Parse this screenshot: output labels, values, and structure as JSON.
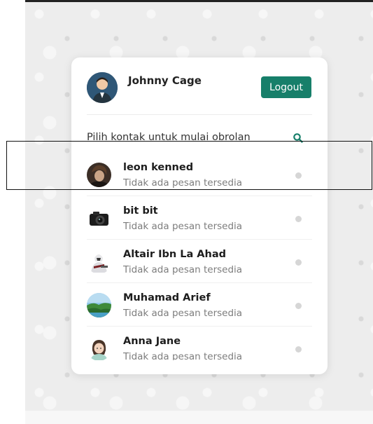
{
  "user": {
    "name": "Johnny Cage"
  },
  "header": {
    "logout_label": "Logout"
  },
  "search": {
    "placeholder": "Pilih kontak untuk mulai obrolan"
  },
  "contacts": [
    {
      "name": "leon kenned",
      "message": "Tidak ada pesan tersedia"
    },
    {
      "name": "bit bit",
      "message": "Tidak ada pesan tersedia"
    },
    {
      "name": "Altair Ibn La Ahad",
      "message": "Tidak ada pesan tersedia"
    },
    {
      "name": "Muhamad Arief",
      "message": "Tidak ada pesan tersedia"
    },
    {
      "name": "Anna Jane",
      "message": "Tidak ada pesan tersedia"
    }
  ],
  "colors": {
    "accent": "#177f6a",
    "status_dot": "#d6d6d6",
    "background_pattern": "#ededed"
  },
  "icons": {
    "search": "search-icon",
    "status": "status-dot-icon"
  }
}
